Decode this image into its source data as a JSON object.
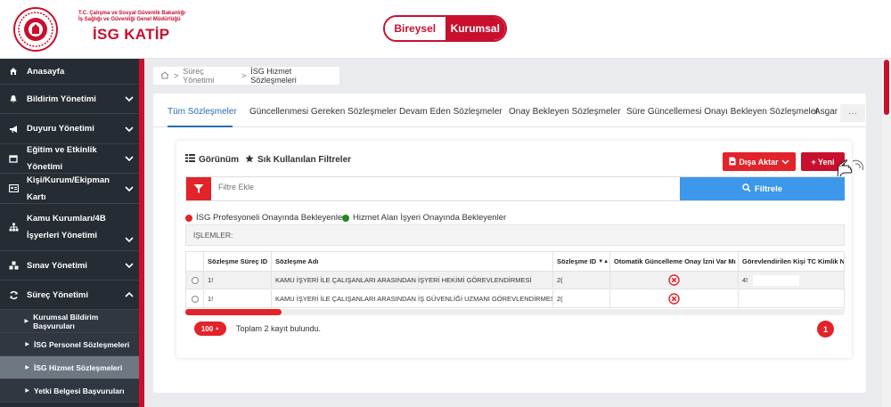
{
  "header": {
    "org_line1": "T.C. Çalışma ve Sosyal Güvenlik Bakanlığı",
    "org_line2": "İş Sağlığı ve Güvenliği Genel Müdürlüğü",
    "brand": "İSG KATİP",
    "toggle": {
      "bireysel": "Bireysel",
      "kurumsal": "Kurumsal",
      "active": "Kurumsal"
    }
  },
  "sidebar": {
    "items": [
      {
        "label": "Anasayfa",
        "icon": "home-icon"
      },
      {
        "label": "Bildirim Yönetimi",
        "icon": "bell-icon"
      },
      {
        "label": "Duyuru Yönetimi",
        "icon": "megaphone-icon"
      },
      {
        "label": "Eğitim ve Etkinlik Yönetimi",
        "icon": "calendar-icon"
      },
      {
        "label": "Kişi/Kurum/Ekipman Kartı",
        "icon": "id-card-icon"
      },
      {
        "label": "Kamu Kurumları/4B İşyerleri Yönetimi",
        "icon": "sitemap-icon"
      },
      {
        "label": "Sınav Yönetimi",
        "icon": "cubes-icon"
      },
      {
        "label": "Süreç Yönetimi",
        "icon": "refresh-icon"
      }
    ],
    "sub_items": [
      {
        "label": "Kurumsal Bildirim Başvuruları"
      },
      {
        "label": "İSG Personel Sözleşmeleri"
      },
      {
        "label": "İSG Hizmet Sözleşmeleri",
        "active": true
      },
      {
        "label": "Yetki Belgesi Başvuruları"
      }
    ]
  },
  "breadcrumb": {
    "level1": "Süreç Yönetimi",
    "level2": "İSG Hizmet Sözleşmeleri"
  },
  "tabs": [
    {
      "label": "Tüm Sözleşmeler",
      "active": true
    },
    {
      "label": "Güncellenmesi Gereken Sözleşmeler"
    },
    {
      "label": "Devam Eden Sözleşmeler"
    },
    {
      "label": "Onay Bekleyen Sözleşmeler"
    },
    {
      "label": "Süre Güncellemesi Onayı Bekleyen Sözleşmeler"
    },
    {
      "label": "Asgar"
    }
  ],
  "tab_more": "···",
  "toolbar": {
    "view_label": "Görünüm",
    "fav_filters_label": "Sık Kullanılan Filtreler",
    "export_label": "Dışa Aktar",
    "new_label": "+ Yeni"
  },
  "filter": {
    "placeholder": "Filtre Ekle",
    "button_label": "Filtrele"
  },
  "legend": {
    "red_label": "İSG Profesyoneli Onayında Bekleyenler",
    "green_label": "Hizmet Alan İşyeri Onayında Bekleyenler",
    "red_color": "#e2232a",
    "green_color": "#1e8b1e"
  },
  "ops_label": "İŞLEMLER:",
  "table": {
    "columns": [
      "",
      "Sözleşme Süreç ID",
      "Sözleşme Adı",
      "Sözleşme ID",
      "Otomatik Güncelleme Onay İzni Var Mı",
      "Görevlendirilen Kişi TC Kimlik No"
    ],
    "rows": [
      {
        "surec_id": "1!",
        "name": "KAMU İŞYERİ İLE ÇALIŞANLARI ARASINDAN İŞYERİ HEKİMİ GÖREVLENDİRMESİ",
        "sozlesme_id": "2(",
        "auto": "x-circle-icon",
        "tc": "4!"
      },
      {
        "surec_id": "1!",
        "name": "KAMU İŞYERİ İLE ÇALIŞANLARI ARASINDAN İŞ GÜVENLİĞİ UZMANI GÖREVLENDİRMESİ",
        "sozlesme_id": "2(",
        "auto": "x-circle-icon",
        "tc": ""
      }
    ]
  },
  "footer": {
    "page_size": "100",
    "total_text": "Toplam 2 kayıt bulundu.",
    "page": "1"
  },
  "colors": {
    "brand_red": "#c8102e",
    "accent_blue": "#3d97ea",
    "sidebar_bg": "#262c33"
  }
}
